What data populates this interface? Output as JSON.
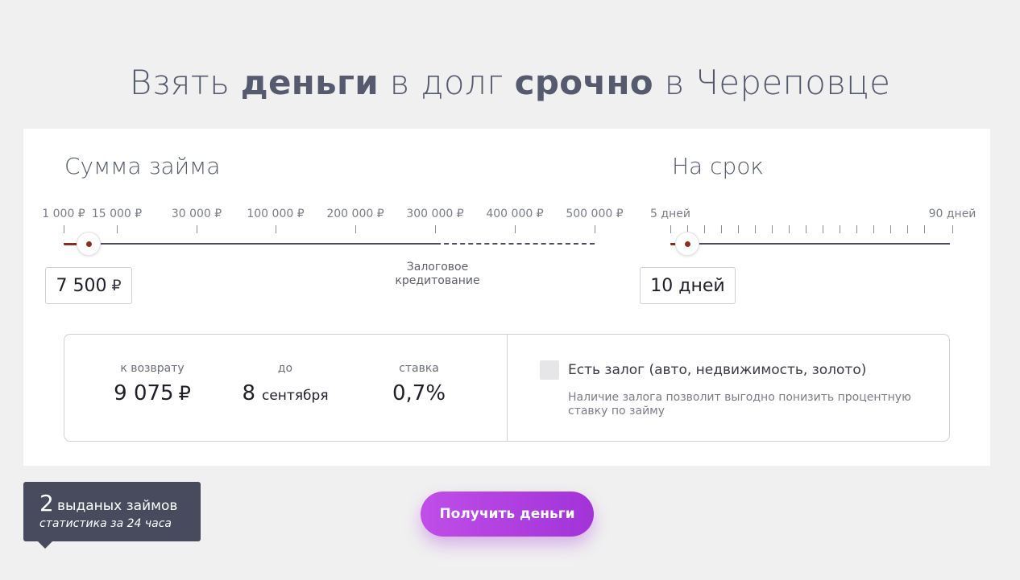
{
  "title": {
    "part1": "Взять ",
    "bold1": "деньги",
    "part2": " в долг ",
    "bold2": "срочно",
    "part3": " в Череповце"
  },
  "loan_amount": {
    "heading": "Сумма займа",
    "ticks": [
      "1 000 ₽",
      "15 000 ₽",
      "30 000 ₽",
      "100 000 ₽",
      "200 000 ₽",
      "300 000 ₽",
      "400 000 ₽",
      "500 000 ₽"
    ],
    "value": "7 500",
    "currency": "₽",
    "collateral_note_line1": "Залоговое",
    "collateral_note_line2": "кредитование"
  },
  "term": {
    "heading": "На срок",
    "min_label": "5 дней",
    "max_label": "90 дней",
    "value": "10 дней"
  },
  "summary": {
    "return_label": "к возврату",
    "return_value": "9 075",
    "return_currency": "₽",
    "due_label": "до",
    "due_day": "8",
    "due_month": "сентября",
    "rate_label": "ставка",
    "rate_value": "0,7%"
  },
  "collateral": {
    "label": "Есть залог (авто, недвижимость, золото)",
    "hint": "Наличие залога позволит выгодно понизить процентную ставку по займу",
    "checked": false
  },
  "stats": {
    "count": "2",
    "text": "выданых займов",
    "sub": "статистика за 24 часа"
  },
  "cta": {
    "label": "Получить деньги"
  },
  "colors": {
    "accent": "#a133d8",
    "slider_fill": "#8b2e1f",
    "badge_bg": "#474b5d"
  }
}
